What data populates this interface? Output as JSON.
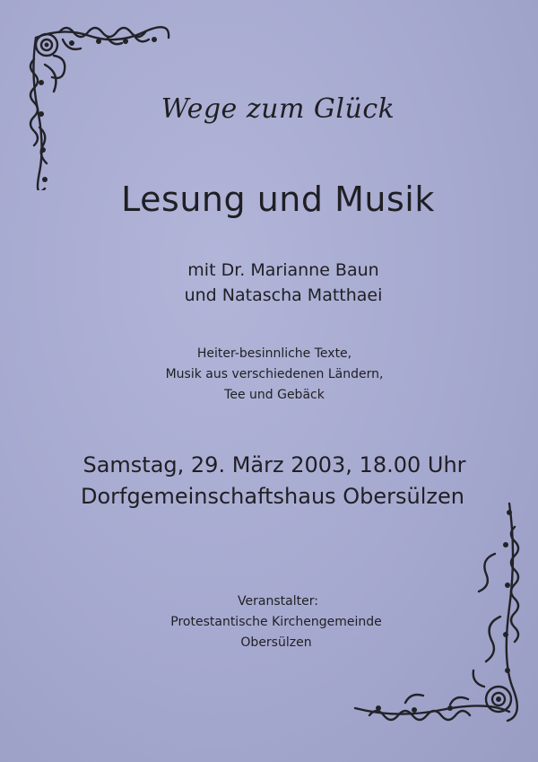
{
  "flyer": {
    "motto": "Wege zum Glück",
    "title": "Lesung und Musik",
    "guests": [
      "mit Dr. Marianne Baun",
      "und Natascha Matthaei"
    ],
    "description": [
      "Heiter-besinnliche Texte,",
      "Musik aus verschiedenen Ländern,",
      "Tee und Gebäck"
    ],
    "date_time": "Samstag, 29. März 2003, 18.00 Uhr",
    "venue": "Dorfgemeinschaftshaus Obersülzen",
    "organizer": [
      "Veranstalter:",
      "Protestantische Kirchengemeinde",
      "Obersülzen"
    ]
  },
  "ornaments": [
    "corner-ornament-top-left",
    "corner-ornament-bottom-right"
  ],
  "colors": {
    "paper": "#a6a9cf",
    "ink": "#1f1f24"
  }
}
